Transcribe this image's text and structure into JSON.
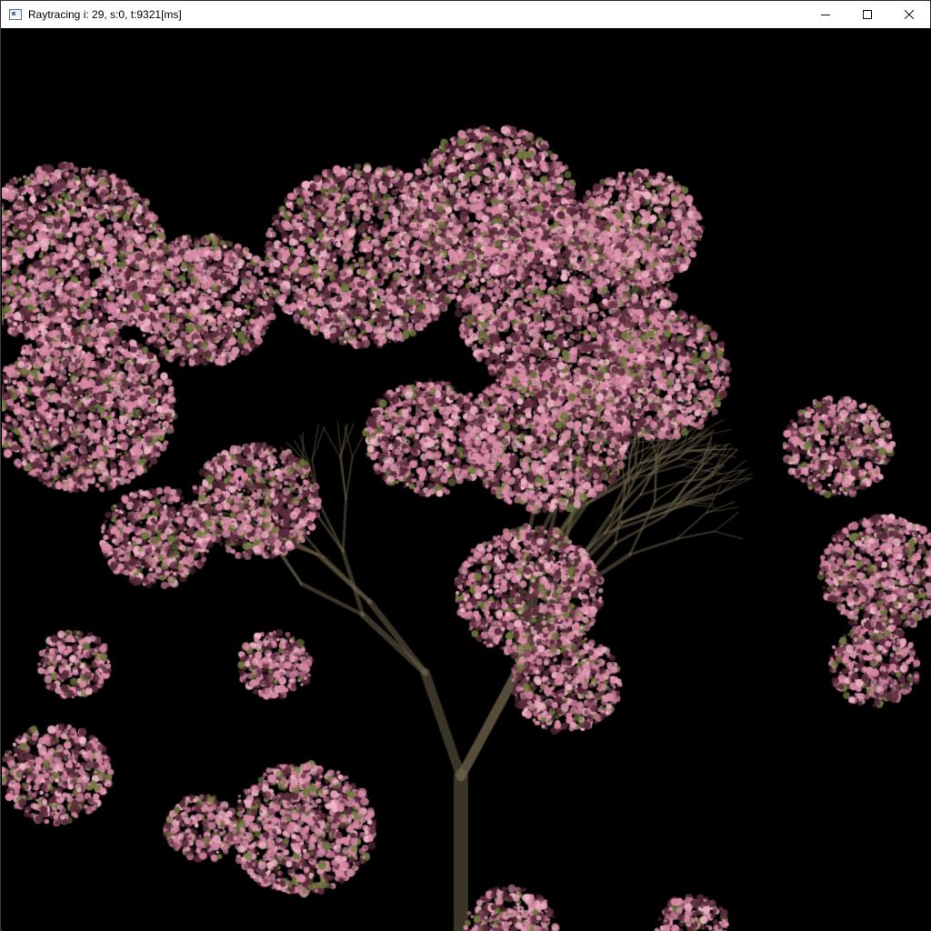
{
  "window": {
    "title": "Raytracing i: 29, s:0, t:9321[ms]",
    "icons": {
      "app": "app-window-icon",
      "minimize": "minimize-icon",
      "maximize": "maximize-icon",
      "close": "close-icon"
    }
  },
  "render": {
    "subject": "cherry-blossom-tree",
    "colors": {
      "background": "#000000",
      "blossom": "#d98aa6",
      "blossom_highlight": "#f0b5c8",
      "blossom_shadow": "#5a2c3c",
      "leaf": "#6f7a3e",
      "branch": "#6b6048"
    }
  }
}
